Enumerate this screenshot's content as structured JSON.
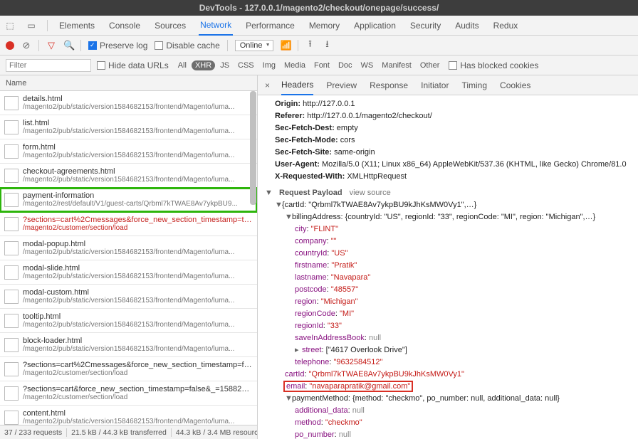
{
  "title": "DevTools - 127.0.0.1/magento2/checkout/onepage/success/",
  "tabs": [
    "Elements",
    "Console",
    "Sources",
    "Network",
    "Performance",
    "Memory",
    "Application",
    "Security",
    "Audits",
    "Redux"
  ],
  "active_tab": "Network",
  "toolbar": {
    "preserve_log": "Preserve log",
    "disable_cache": "Disable cache",
    "throttle": "Online"
  },
  "filter": {
    "placeholder": "Filter",
    "hide_data": "Hide data URLs",
    "chips": [
      "All",
      "XHR",
      "JS",
      "CSS",
      "Img",
      "Media",
      "Font",
      "Doc",
      "WS",
      "Manifest",
      "Other"
    ],
    "active_chip": "XHR",
    "has_blocked": "Has blocked cookies"
  },
  "name_header": "Name",
  "requests": [
    {
      "l1": "details.html",
      "l2": "/magento2/pub/static/version1584682153/frontend/Magento/luma..."
    },
    {
      "l1": "list.html",
      "l2": "/magento2/pub/static/version1584682153/frontend/Magento/luma..."
    },
    {
      "l1": "form.html",
      "l2": "/magento2/pub/static/version1584682153/frontend/Magento/luma..."
    },
    {
      "l1": "checkout-agreements.html",
      "l2": "/magento2/pub/static/version1584682153/frontend/Magento/luma..."
    },
    {
      "l1": "payment-information",
      "l2": "/magento2/rest/default/V1/guest-carts/Qrbml7kTWAE8Av7ykpBU9...",
      "green": true
    },
    {
      "l1": "?sections=cart%2Cmessages&force_new_section_timestamp=true&...",
      "l2": "/magento2/customer/section/load",
      "red": true
    },
    {
      "l1": "modal-popup.html",
      "l2": "/magento2/pub/static/version1584682153/frontend/Magento/luma..."
    },
    {
      "l1": "modal-slide.html",
      "l2": "/magento2/pub/static/version1584682153/frontend/Magento/luma..."
    },
    {
      "l1": "modal-custom.html",
      "l2": "/magento2/pub/static/version1584682153/frontend/Magento/luma..."
    },
    {
      "l1": "tooltip.html",
      "l2": "/magento2/pub/static/version1584682153/frontend/Magento/luma..."
    },
    {
      "l1": "block-loader.html",
      "l2": "/magento2/pub/static/version1584682153/frontend/Magento/luma..."
    },
    {
      "l1": "?sections=cart%2Cmessages&force_new_section_timestamp=false&...",
      "l2": "/magento2/customer/section/load"
    },
    {
      "l1": "?sections=cart&force_new_section_timestamp=false&_=158823131...",
      "l2": "/magento2/customer/section/load"
    },
    {
      "l1": "content.html",
      "l2": "/magento2/pub/static/version1584682153/frontend/Magento/luma..."
    }
  ],
  "status": {
    "count": "37 / 233 requests",
    "transferred": "21.5 kB / 44.3 kB transferred",
    "resources": "44.3 kB / 3.4 MB resourc"
  },
  "detail_tabs": [
    "Headers",
    "Preview",
    "Response",
    "Initiator",
    "Timing",
    "Cookies"
  ],
  "active_detail_tab": "Headers",
  "req_headers": {
    "Origin": "http://127.0.0.1",
    "Referer": "http://127.0.0.1/magento2/checkout/",
    "Sec-Fetch-Dest": "empty",
    "Sec-Fetch-Mode": "cors",
    "Sec-Fetch-Site": "same-origin",
    "User-Agent": "Mozilla/5.0 (X11; Linux x86_64) AppleWebKit/537.36 (KHTML, like Gecko) Chrome/81.0",
    "X-Requested-With": "XMLHttpRequest"
  },
  "payload_label": "Request Payload",
  "view_source": "view source",
  "payload_top": "{cartId: \"Qrbml7kTWAE8Av7ykpBU9kJhKsMW0Vy1\",…}",
  "billing_top": "billingAddress: {countryId: \"US\", regionId: \"33\", regionCode: \"MI\", region: \"Michigan\",…}",
  "billing": {
    "city": "\"FLINT\"",
    "company": "\"\"",
    "countryId": "\"US\"",
    "firstname": "\"Pratik\"",
    "lastname": "\"Navapara\"",
    "postcode": "\"48557\"",
    "region": "\"Michigan\"",
    "regionCode": "\"MI\"",
    "regionId": "\"33\"",
    "saveInAddressBook": "null",
    "street_label": "street",
    "street_val": "[\"4617 Overlook Drive\"]",
    "telephone": "\"9632584512\""
  },
  "cartId": "\"Qrbml7kTWAE8Av7ykpBU9kJhKsMW0Vy1\"",
  "email": "\"navaparapratik@gmail.com\"",
  "pm_top": "paymentMethod: {method: \"checkmo\", po_number: null, additional_data: null}",
  "pm": {
    "additional_data": "null",
    "method": "\"checkmo\"",
    "po_number": "null"
  }
}
